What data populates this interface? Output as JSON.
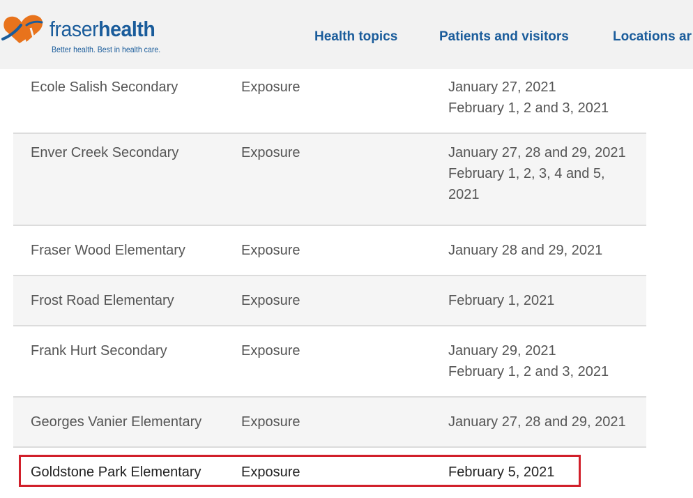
{
  "brand": {
    "name_light": "fraser",
    "name_bold": "health",
    "tagline": "Better health. Best in health care.",
    "logo_colors": {
      "orange": "#e8731c",
      "blue": "#1a5c9b"
    }
  },
  "nav": {
    "items": [
      {
        "label": "Health topics"
      },
      {
        "label": "Patients and visitors"
      },
      {
        "label": "Locations ar"
      }
    ]
  },
  "table": {
    "rows": [
      {
        "school": "Ecole Salish Secondary",
        "type": "Exposure",
        "dates": "January 27, 2021\nFebruary 1, 2 and 3, 2021"
      },
      {
        "school": "Enver Creek Secondary",
        "type": "Exposure",
        "dates": "January 27, 28 and 29, 2021\nFebruary 1, 2, 3, 4 and 5,\n2021"
      },
      {
        "school": "Fraser Wood Elementary",
        "type": "Exposure",
        "dates": "January 28 and 29, 2021"
      },
      {
        "school": "Frost Road Elementary",
        "type": "Exposure",
        "dates": "February 1, 2021"
      },
      {
        "school": "Frank Hurt Secondary",
        "type": "Exposure",
        "dates": "January 29, 2021\nFebruary 1, 2 and 3, 2021"
      },
      {
        "school": "Georges Vanier Elementary",
        "type": "Exposure",
        "dates": "January 27, 28 and 29, 2021"
      },
      {
        "school": "Goldstone Park Elementary",
        "type": "Exposure",
        "dates": "February 5, 2021"
      }
    ]
  },
  "colors": {
    "header_bg": "#f2f2f2",
    "link": "#1a5c9b",
    "highlight": "#d11f2a"
  }
}
